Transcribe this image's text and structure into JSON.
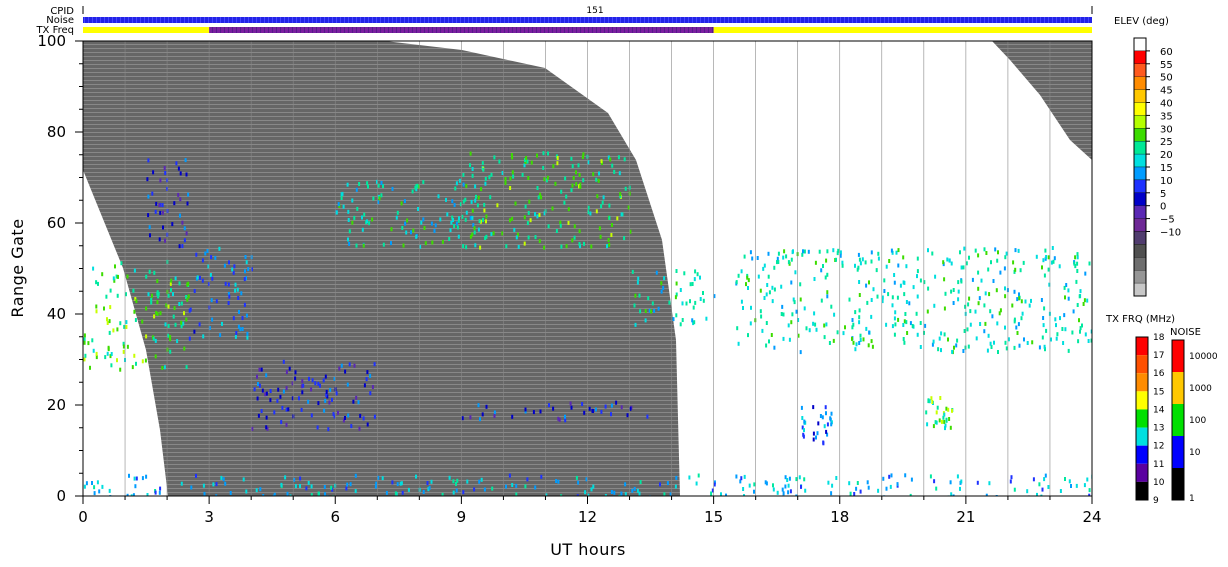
{
  "header_rows": {
    "cpid_label": "CPID",
    "noise_label": "Noise",
    "txfreq_label": "TX Freq",
    "cpid_value": "151"
  },
  "colorbars": {
    "elev": {
      "title": "ELEV (deg)",
      "labels": [
        "60",
        "55",
        "50",
        "45",
        "40",
        "35",
        "30",
        "25",
        "20",
        "15",
        "10",
        "5",
        "0",
        "−5",
        "−10"
      ],
      "colors": [
        "#ffffff",
        "#ff0000",
        "#ff5a1e",
        "#ff8c00",
        "#ffc800",
        "#ffff00",
        "#b4ff00",
        "#3cdc00",
        "#00e896",
        "#00e0e0",
        "#009cff",
        "#1e32ff",
        "#0000c8",
        "#5a28b4",
        "#6e2896",
        "#503c6e",
        "#505050",
        "#6e6e6e",
        "#969696",
        "#c8c8c8"
      ]
    },
    "txfrq": {
      "title": "TX FRQ (MHz)",
      "labels": [
        "18",
        "17",
        "16",
        "15",
        "14",
        "13",
        "12",
        "11",
        "10",
        "9"
      ],
      "colors": [
        "#ff0000",
        "#ff5000",
        "#ff8c00",
        "#ffff00",
        "#00e000",
        "#00e0e0",
        "#0000ff",
        "#5a00a0",
        "#000000"
      ]
    },
    "noise": {
      "title": "NOISE",
      "labels": [
        "10000",
        "1000",
        "100",
        "10",
        "1"
      ],
      "colors": [
        "#ff0000",
        "#ffc800",
        "#00e000",
        "#0000ff",
        "#000000"
      ]
    }
  },
  "chart_data": {
    "type": "heatmap",
    "title": "",
    "xlabel": "UT hours",
    "ylabel": "Range Gate",
    "xlim": [
      0,
      24
    ],
    "ylim": [
      0,
      100
    ],
    "xticks": [
      "0",
      "3",
      "6",
      "9",
      "12",
      "15",
      "18",
      "21",
      "24"
    ],
    "yticks": [
      "0",
      "20",
      "40",
      "60",
      "80",
      "100"
    ],
    "colorbar": "ELEV (deg)",
    "no_data_color": "#ffffff",
    "ground_scatter_color": "#646464",
    "ground_scatter_boundary": {
      "description": "approximate gate extent of the grey ground-scatter region",
      "left_edge": [
        [
          0,
          74
        ],
        [
          1,
          48
        ],
        [
          1.5,
          32
        ],
        [
          1.8,
          15
        ],
        [
          2.05,
          0
        ]
      ],
      "right_edge": [
        [
          7.2,
          100
        ],
        [
          9,
          98
        ],
        [
          11,
          92
        ],
        [
          12.5,
          82
        ],
        [
          13.2,
          70
        ],
        [
          13.8,
          55
        ],
        [
          14.1,
          35
        ],
        [
          14.2,
          0
        ]
      ],
      "top_right_region": [
        [
          21.5,
          100
        ],
        [
          22.5,
          95
        ],
        [
          23.5,
          88
        ],
        [
          24,
          75
        ]
      ]
    },
    "echo_regions": [
      {
        "x": [
          0,
          2.5
        ],
        "gate": [
          28,
          52
        ],
        "elev_deg": 35
      },
      {
        "x": [
          1.5,
          2.5
        ],
        "gate": [
          55,
          75
        ],
        "elev_deg": 15
      },
      {
        "x": [
          2.5,
          4
        ],
        "gate": [
          35,
          55
        ],
        "elev_deg": 20
      },
      {
        "x": [
          4,
          7
        ],
        "gate": [
          15,
          30
        ],
        "elev_deg": 15
      },
      {
        "x": [
          6,
          9.5
        ],
        "gate": [
          55,
          70
        ],
        "elev_deg": 30
      },
      {
        "x": [
          9,
          13
        ],
        "gate": [
          55,
          76
        ],
        "elev_deg": 35
      },
      {
        "x": [
          9,
          13.5
        ],
        "gate": [
          17,
          21
        ],
        "elev_deg": 15
      },
      {
        "x": [
          13,
          15
        ],
        "gate": [
          38,
          50
        ],
        "elev_deg": 30
      },
      {
        "x": [
          15.5,
          24
        ],
        "gate": [
          32,
          55
        ],
        "elev_deg": 30
      },
      {
        "x": [
          17,
          17.8
        ],
        "gate": [
          12,
          20
        ],
        "elev_deg": 20
      },
      {
        "x": [
          20,
          20.7
        ],
        "gate": [
          15,
          22
        ],
        "elev_deg": 35
      },
      {
        "x": [
          0,
          24
        ],
        "gate": [
          0,
          5
        ],
        "elev_deg": 25
      }
    ],
    "tx_freq_row": {
      "default": "yellow",
      "purple_interval": [
        3,
        15
      ]
    },
    "noise_row": {
      "color": "blue"
    }
  }
}
